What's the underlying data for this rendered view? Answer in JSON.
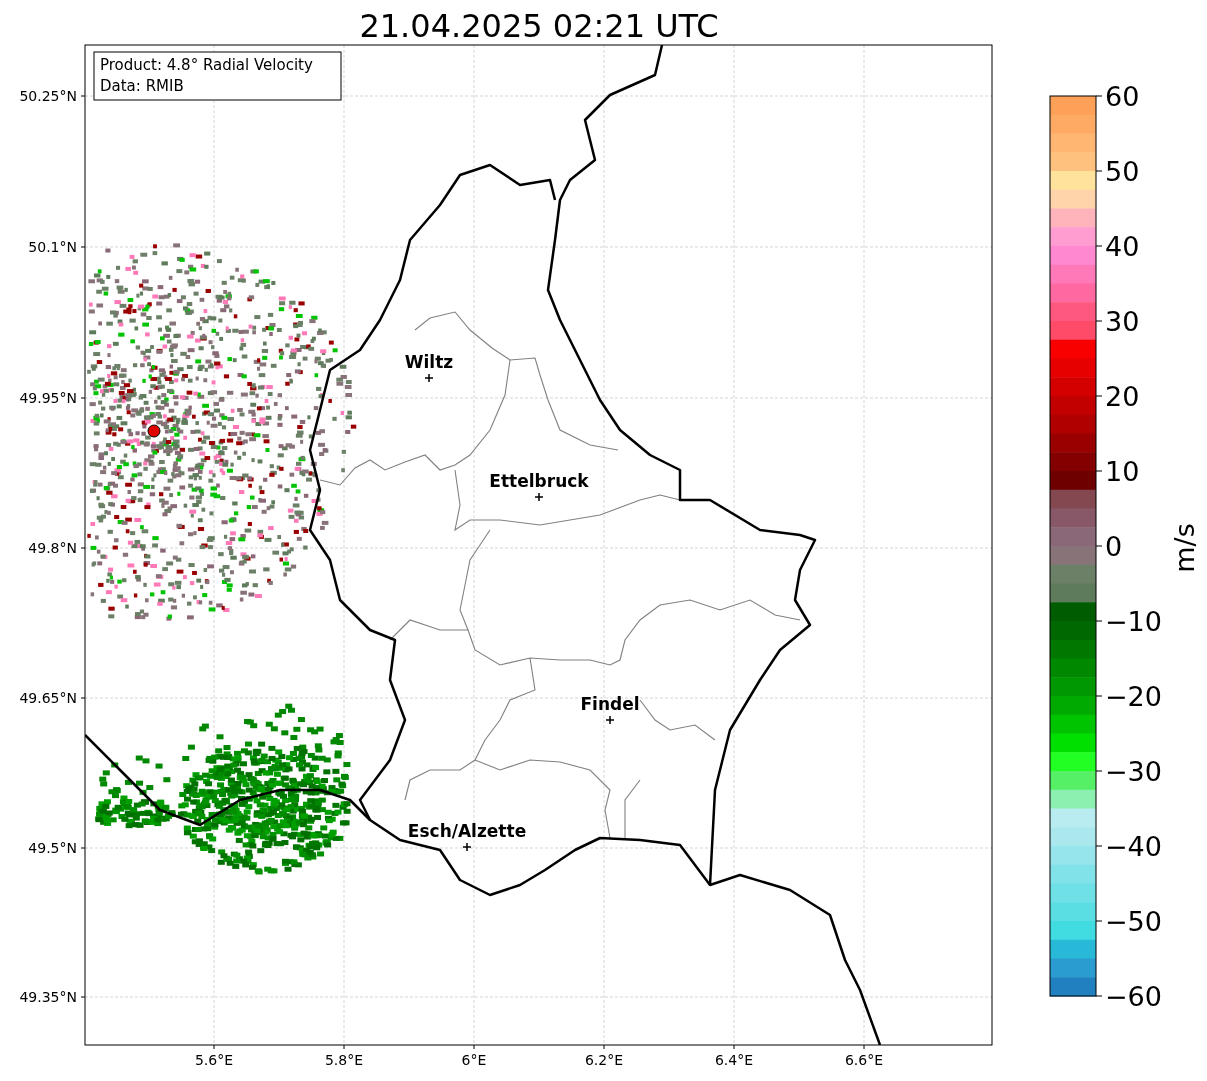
{
  "title": "21.04.2025 02:21 UTC",
  "info_box": [
    "Product: 4.8° Radial Velocity",
    "Data: RMIB"
  ],
  "map": {
    "y_ticks": [
      "50.25°N",
      "50.1°N",
      "49.95°N",
      "49.8°N",
      "49.65°N",
      "49.5°N",
      "49.35°N"
    ],
    "x_ticks": [
      "5.6°E",
      "5.8°E",
      "6°E",
      "6.2°E",
      "6.4°E",
      "6.6°E"
    ],
    "cities": [
      {
        "name": "Wiltz"
      },
      {
        "name": "Ettelbruck"
      },
      {
        "name": "Findel"
      },
      {
        "name": "Esch/Alzette"
      }
    ]
  },
  "colorbar": {
    "label": "m/s",
    "ticks": [
      "60",
      "50",
      "40",
      "30",
      "20",
      "10",
      "0",
      "−10",
      "−20",
      "−30",
      "−40",
      "−50",
      "−60"
    ]
  }
}
